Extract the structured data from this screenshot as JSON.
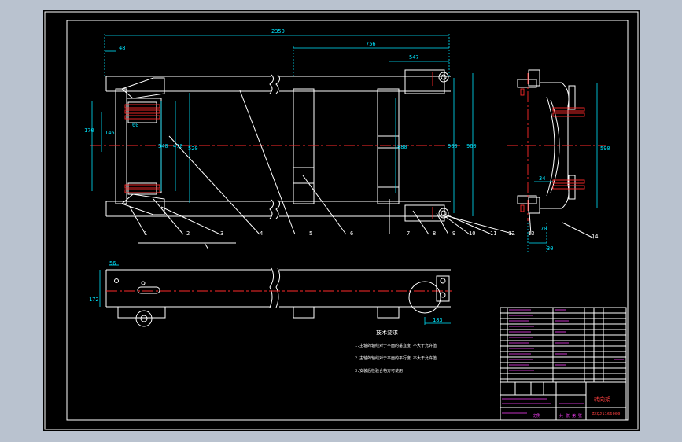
{
  "dimensions": {
    "d2350": "2350",
    "d756": "756",
    "d547": "547",
    "d48": "48",
    "d170": "170",
    "d146": "146",
    "d60": "60",
    "d540": "540",
    "d470": "470",
    "d520": "520",
    "d880": "880",
    "d900": "900",
    "d960": "960",
    "d590": "590",
    "d34": "34",
    "d70": "70",
    "d30": "30",
    "d56": "56",
    "d172": "172",
    "d183": "183"
  },
  "balloons": [
    "1",
    "2",
    "3",
    "4",
    "5",
    "6",
    "7",
    "8",
    "9",
    "10",
    "11",
    "12",
    "13",
    "14"
  ],
  "notes": {
    "title": "技术要求",
    "line1": "1.主轴的轴线对于平面的垂直度 不大于允许值",
    "line2": "2.主轴的轴线对于平面的平行度 不大于允许值",
    "line3": "3.安装后检验合格方可使用"
  },
  "title_block": {
    "title": "转向架",
    "code": "ZXQJ1166000",
    "scale_label": "比例",
    "sheet_label": "共 张 第 张"
  }
}
